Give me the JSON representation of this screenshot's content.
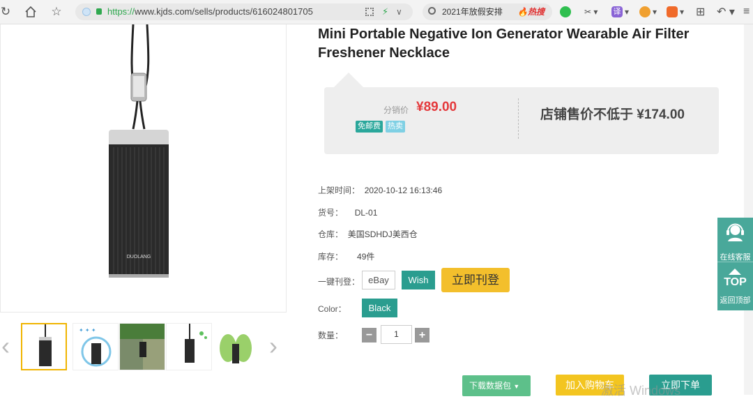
{
  "browser": {
    "url_scheme": "https://",
    "url_rest": "www.kjds.com/sells/products/616024801705",
    "search_query": "2021年放假安排",
    "search_hot": "热搜",
    "ext_translate": "译"
  },
  "product": {
    "title": "Mini Portable Negative Ion Generator Wearable Air Filter Freshener Necklace",
    "image_brand_text": "DUOLANG",
    "price_label": "分销价",
    "price": "¥89.00",
    "badges": [
      "免邮费",
      "热卖"
    ],
    "min_retail": "店铺售价不低于 ¥174.00",
    "fields": [
      {
        "label": "上架时间：",
        "value": "2020-10-12 16:13:46"
      },
      {
        "label": "货号：",
        "value": "DL-01"
      },
      {
        "label": "仓库：",
        "value": "美国SDHDJ美西仓"
      },
      {
        "label": "库存：",
        "value": "49件"
      }
    ],
    "listing_label": "一键刊登：",
    "platforms": [
      "eBay",
      "Wish"
    ],
    "list_now": "立即刊登",
    "color_label": "Color：",
    "color_value": "Black",
    "qty_label": "数量：",
    "qty_value": "1",
    "qty_minus": "−",
    "qty_plus": "+"
  },
  "actions": {
    "download": "下载数据包",
    "add_cart": "加入购物车",
    "buy_now": "立即下单",
    "watermark": "激活 Windows"
  },
  "float_panel": {
    "service": "在线客服",
    "top_big": "TOP",
    "top_label": "返回顶部"
  },
  "colors": {
    "accent_teal": "#2a9d8f",
    "price_red": "#e4393c",
    "list_yellow": "#f3bf2c",
    "download_green": "#5dc08a"
  }
}
